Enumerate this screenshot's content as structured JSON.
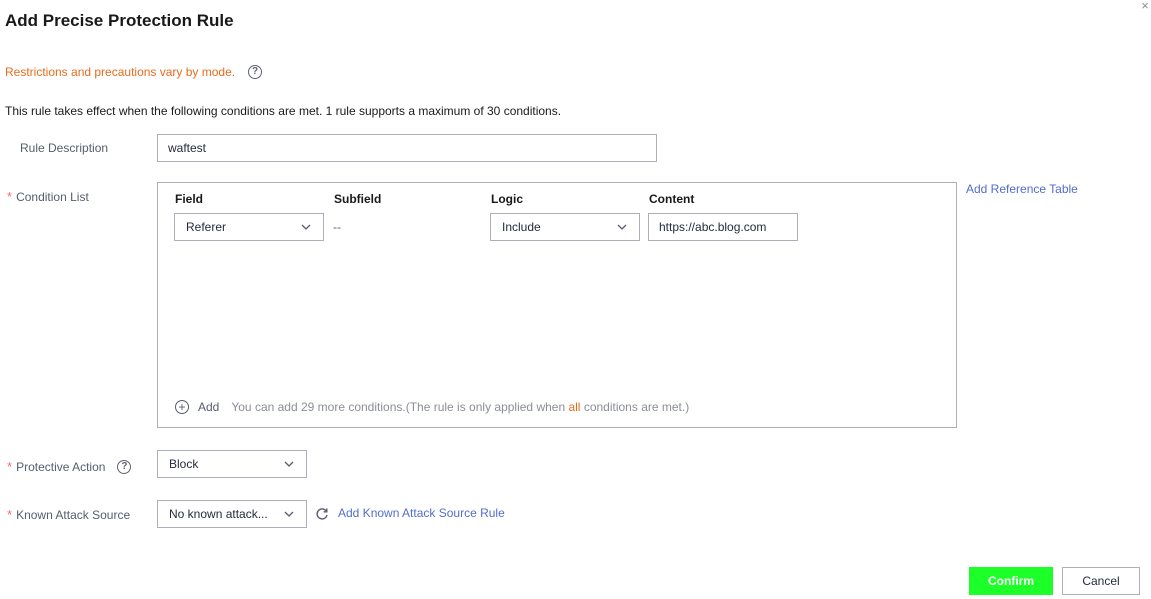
{
  "dialog": {
    "title": "Add Precise Protection Rule",
    "close_icon": "close-icon",
    "notice": "Restrictions and precautions vary by mode.",
    "info": "This rule takes effect when the following conditions are met. 1 rule supports a maximum of 30 conditions."
  },
  "rule_description": {
    "label": "Rule Description",
    "value": "waftest"
  },
  "condition_list": {
    "label": "Condition List",
    "required": "*",
    "columns": [
      "Field",
      "Subfield",
      "Logic",
      "Content"
    ],
    "rows": [
      {
        "field": "Referer",
        "subfield": "--",
        "logic": "Include",
        "content": "https://abc.blog.com"
      }
    ],
    "add_label": "Add",
    "add_hint_prefix": "You can add 29 more conditions.(The rule is only applied when ",
    "add_hint_highlight": "all",
    "add_hint_suffix": " conditions are met.)",
    "reference_link": "Add Reference Table"
  },
  "protective_action": {
    "label": "Protective Action",
    "required": "*",
    "value": "Block"
  },
  "known_attack_source": {
    "label": "Known Attack Source",
    "required": "*",
    "value": "No known attack...",
    "link": "Add Known Attack Source Rule"
  },
  "footer": {
    "confirm": "Confirm",
    "cancel": "Cancel"
  },
  "colors": {
    "accent_link": "#526ecc",
    "notice": "#e56c1d",
    "required": "#f66f6a",
    "confirm_bg": "#1cff28"
  }
}
